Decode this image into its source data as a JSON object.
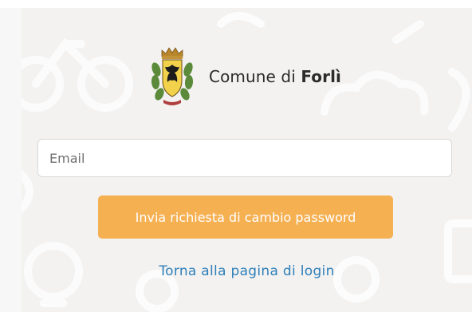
{
  "brand": {
    "name_prefix": "Comune di",
    "name_city": "Forlì",
    "crest_icon": "city-crest-icon"
  },
  "form": {
    "email_placeholder": "Email",
    "email_value": "",
    "submit_label": "Invia richiesta di cambio password",
    "back_link_label": "Torna alla pagina di login"
  },
  "colors": {
    "panel_bg": "#f3f2f1",
    "button_bg": "#f5b052",
    "button_text": "#ffffff",
    "link": "#2f7fb8"
  }
}
